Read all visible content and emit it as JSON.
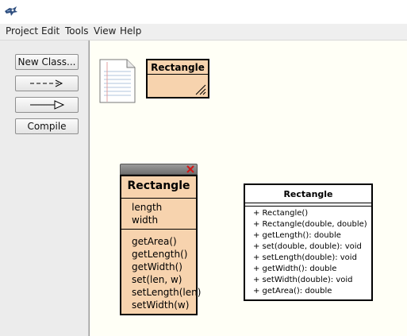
{
  "menu": {
    "items": [
      "Project",
      "Edit",
      "Tools",
      "View",
      "Help"
    ]
  },
  "toolbar": {
    "new_class_label": "New Class...",
    "dependency_arrow_label": "--->",
    "inheritance_arrow_label": "—▷",
    "compile_label": "Compile"
  },
  "diagram": {
    "class_small": {
      "name": "Rectangle"
    }
  },
  "editor": {
    "class_name": "Rectangle",
    "fields": [
      "length",
      "width"
    ],
    "methods": [
      "getArea()",
      "getLength()",
      "getWidth()",
      "set(len, w)",
      "setLength(len)",
      "setWidth(w)"
    ]
  },
  "uml": {
    "class_name": "Rectangle",
    "members": [
      "+ Rectangle()",
      "+ Rectangle(double, double)",
      "+ getLength(): double",
      "+ set(double, double): void",
      "+ setLength(double): void",
      "+ getWidth(): double",
      "+ setWidth(double): void",
      "+ getArea(): double"
    ]
  },
  "colors": {
    "class_fill": "#f7d3ae",
    "canvas": "#fffff6",
    "panel": "#ececec",
    "close_red": "#d01818"
  },
  "icons": [
    "app-bird-icon",
    "readme-document-icon",
    "resize-grip-icon",
    "close-icon"
  ]
}
